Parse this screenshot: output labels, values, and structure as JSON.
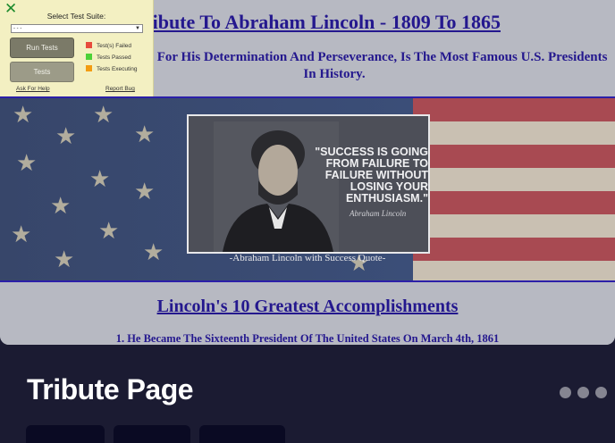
{
  "preview": {
    "header_title": "A Tribute To Abraham Lincoln - 1809 To 1865",
    "header_subtitle": "Lincoln, Known For His Determination And Perseverance, Is The Most Famous U.S. Presidents In History.",
    "image_quote": "\"SUCCESS IS GOING FROM FAILURE TO FAILURE WITHOUT LOSING YOUR ENTHUSIASM.\"",
    "image_signature": "Abraham Lincoln",
    "image_caption": "-Abraham Lincoln with Success Quote-",
    "section_heading": "Lincoln's 10 Greatest Accomplishments",
    "first_item": "1. He Became The Sixteenth President Of The United States On March 4th, 1861"
  },
  "test_panel": {
    "close_glyph": "✕",
    "select_label": "Select Test Suite:",
    "select_value": "- - -",
    "run_button": "Run Tests",
    "tests_button": "Tests",
    "legend": [
      {
        "label": "Test(s) Failed",
        "color": "#e74c3c"
      },
      {
        "label": "Tests Passed",
        "color": "#4cd137"
      },
      {
        "label": "Tests Executing",
        "color": "#f39c12"
      }
    ],
    "help_link": "Ask For Help",
    "bug_link": "Report Bug"
  },
  "card": {
    "title": "Tribute Page"
  }
}
